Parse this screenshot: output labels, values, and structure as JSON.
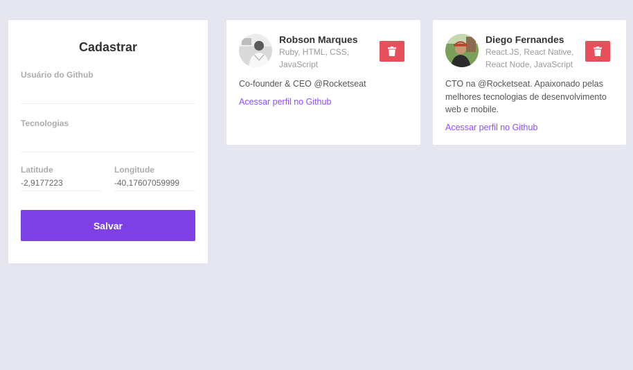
{
  "form": {
    "title": "Cadastrar",
    "github_label": "Usuário do Github",
    "github_value": "",
    "techs_label": "Tecnologias",
    "techs_value": "",
    "latitude_label": "Latitude",
    "latitude_value": "-2,9177223",
    "longitude_label": "Longitude",
    "longitude_value": "-40,17607059999",
    "save_label": "Salvar"
  },
  "devs": [
    {
      "name": "Robson Marques",
      "techs": "Ruby, HTML, CSS, JavaScript",
      "bio": "Co-founder & CEO @Rocketseat",
      "link": "Acessar perfil no Github",
      "avatar_icon": "avatar-photo"
    },
    {
      "name": "Diego Fernandes",
      "techs": "React.JS, React Native, React Node, JavaScript",
      "bio": "CTO na @Rocketseat. Apaixonado pelas melhores tecnologias de desenvolvimento web e mobile.",
      "link": "Acessar perfil no Github",
      "avatar_icon": "avatar-photo"
    }
  ],
  "colors": {
    "background": "#e6e6f0",
    "primary": "#7d40e7",
    "danger": "#e84e5b",
    "link": "#8e4dff"
  },
  "icons": {
    "delete": "trash-icon"
  }
}
